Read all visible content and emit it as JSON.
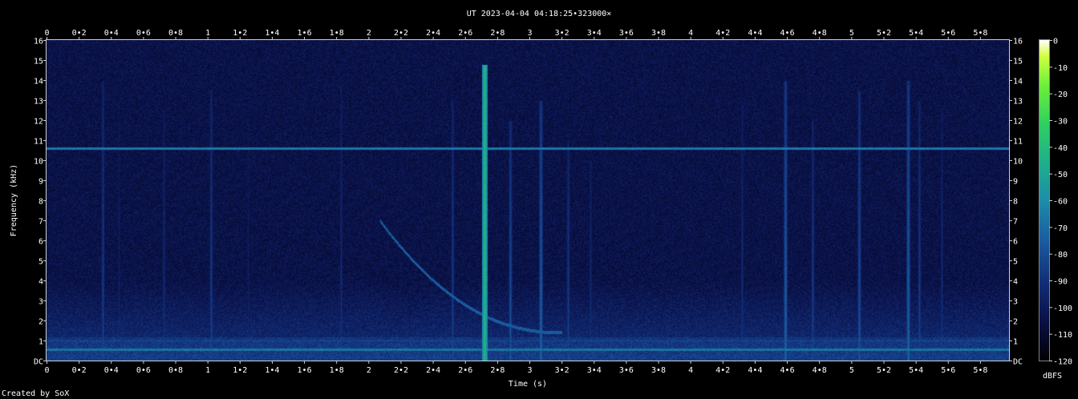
{
  "chart_data": {
    "type": "heatmap",
    "title": "UT 2023-04-04 04:18:25•323000×",
    "xlabel": "Time (s)",
    "ylabel": "Frequency (kHz)",
    "colorbar_label": "dBFS",
    "credit": "Created by SoX",
    "xlim": [
      0,
      5.98
    ],
    "ylim": [
      0,
      16
    ],
    "x_ticks": [
      "0",
      "0•2",
      "0•4",
      "0•6",
      "0•8",
      "1",
      "1•2",
      "1•4",
      "1•6",
      "1•8",
      "2",
      "2•2",
      "2•4",
      "2•6",
      "2•8",
      "3",
      "3•2",
      "3•4",
      "3•6",
      "3•8",
      "4",
      "4•2",
      "4•4",
      "4•6",
      "4•8",
      "5",
      "5•2",
      "5•4",
      "5•6",
      "5•8"
    ],
    "y_ticks": [
      "DC",
      "1",
      "2",
      "3",
      "4",
      "5",
      "6",
      "7",
      "8",
      "9",
      "10",
      "11",
      "12",
      "13",
      "14",
      "15",
      "16"
    ],
    "colorbar_ticks": [
      "0",
      "-10",
      "-20",
      "-30",
      "-40",
      "-50",
      "-60",
      "-70",
      "-80",
      "-90",
      "-100",
      "-110",
      "-120"
    ],
    "colorbar_range": [
      -120,
      0
    ],
    "colormap": [
      "#000000",
      "#0a0f45",
      "#12307a",
      "#1a5ea0",
      "#1c8ea8",
      "#1fb08a",
      "#2fd060",
      "#6ef03a",
      "#d0ff40",
      "#ffffff"
    ],
    "features": {
      "hum_band_khz": 10.6,
      "low_band_khz": [
        0.55,
        1.0
      ],
      "whistler_curve": {
        "t0": 2.07,
        "f0": 7.0,
        "t1": 3.2,
        "f1": 1.4
      },
      "strong_impulse_t": 2.72,
      "impulses": [
        {
          "t": 0.35,
          "f": 14.0,
          "level": -90
        },
        {
          "t": 0.45,
          "f": 13.0,
          "level": -100
        },
        {
          "t": 0.73,
          "f": 12.5,
          "level": -95
        },
        {
          "t": 1.02,
          "f": 13.5,
          "level": -90
        },
        {
          "t": 1.25,
          "f": 12.0,
          "level": -100
        },
        {
          "t": 1.83,
          "f": 13.8,
          "level": -95
        },
        {
          "t": 2.52,
          "f": 13.0,
          "level": -90
        },
        {
          "t": 2.72,
          "f": 14.8,
          "level": -60
        },
        {
          "t": 2.88,
          "f": 12.0,
          "level": -85
        },
        {
          "t": 3.07,
          "f": 13.0,
          "level": -80
        },
        {
          "t": 3.24,
          "f": 11.0,
          "level": -90
        },
        {
          "t": 3.38,
          "f": 10.0,
          "level": -95
        },
        {
          "t": 4.32,
          "f": 13.0,
          "level": -95
        },
        {
          "t": 4.59,
          "f": 14.0,
          "level": -80
        },
        {
          "t": 4.76,
          "f": 12.0,
          "level": -90
        },
        {
          "t": 5.05,
          "f": 13.5,
          "level": -85
        },
        {
          "t": 5.35,
          "f": 14.0,
          "level": -80
        },
        {
          "t": 5.42,
          "f": 13.0,
          "level": -90
        },
        {
          "t": 5.56,
          "f": 12.5,
          "level": -95
        }
      ]
    }
  }
}
